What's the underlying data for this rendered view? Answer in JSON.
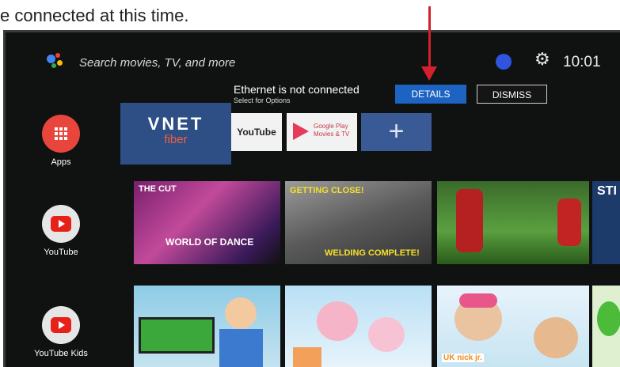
{
  "caption": "e connected at this time.",
  "search": {
    "placeholder": "Search movies, TV, and more"
  },
  "clock": "10:01",
  "notification": {
    "title": "Ethernet is not connected",
    "subtitle": "Select for Options",
    "details_label": "DETAILS",
    "dismiss_label": "DISMISS"
  },
  "sidebar": {
    "items": [
      {
        "label": "Apps",
        "color": "#e8453c"
      },
      {
        "label": "YouTube",
        "color": "#e6e6e6"
      },
      {
        "label": "YouTube Kids",
        "color": "#e6e6e6"
      }
    ]
  },
  "apps_row": {
    "vnet_line1": "VNET",
    "vnet_line2": "fiber",
    "youtube": "YouTube",
    "google_play_line1": "Google Play",
    "google_play_line2": "Movies & TV",
    "add": "+"
  },
  "youtube_row": {
    "tile1_title": "THE CUT",
    "tile1_overlay": "WORLD OF DANCE",
    "tile2_top": "GETTING CLOSE!",
    "tile2_bottom": "WELDING COMPLETE!",
    "tile4_partial": "STI"
  },
  "kids_row": {
    "tile3_badge": "UK nick jr."
  },
  "colors": {
    "accent": "#1d63c2",
    "annotation_arrow": "#d4202a"
  }
}
